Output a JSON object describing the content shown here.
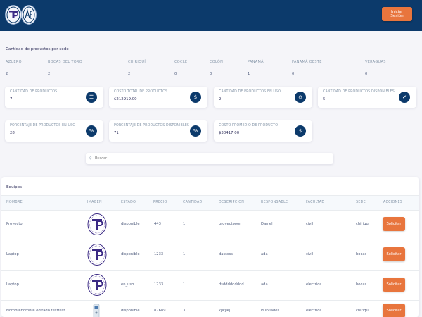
{
  "header": {
    "login_label": "Iniciar Sesión"
  },
  "sedes": {
    "title": "Cantidad de productos por sede",
    "columns": [
      "AZUERO",
      "BOCAS DEL TORO",
      "CHIRIQUÍ",
      "COCLÉ",
      "COLÓN",
      "PANAMÁ",
      "PANAMÁ OESTE",
      "VERAGUAS"
    ],
    "values": [
      "2",
      "2",
      "2",
      "0",
      "0",
      "1",
      "0",
      "0"
    ]
  },
  "stats": [
    {
      "label": "CANTIDAD DE PRODUCTOS",
      "value": "7",
      "icon": "table-icon"
    },
    {
      "label": "COSTO TOTAL DE PRODUCTOS",
      "value": "$212919.00",
      "icon": "dollar-icon"
    },
    {
      "label": "CANTIDAD DE PRODUCTOS EN USO",
      "value": "2",
      "icon": "in-use-icon"
    },
    {
      "label": "CANTIDAD DE PRODUCTOS DISPONIBLES",
      "value": "5",
      "icon": "check-icon"
    },
    {
      "label": "PORCENTAJE DE PRODUCTOS EN USO",
      "value": "28",
      "icon": "percent-icon"
    },
    {
      "label": "PORCENTAJE DE PRODUCTOS DISPONIBLES",
      "value": "71",
      "icon": "percent-icon"
    },
    {
      "label": "COSTO PROMEDIO DE PRODUCTO",
      "value": "$30417.00",
      "icon": "dollar-icon"
    }
  ],
  "search": {
    "placeholder": "Buscar..."
  },
  "equipos": {
    "title": "Equipos",
    "headers": [
      "NOMBRE",
      "IMAGEN",
      "ESTADO",
      "PRECIO",
      "CANTIDAD",
      "DESCRIPCION",
      "RESPONSABLE",
      "FACULTAD",
      "SEDE",
      "ACCIONES"
    ],
    "rows": [
      {
        "nombre": "Proyector",
        "estado": "disponible",
        "precio": "443",
        "cantidad": "1",
        "descripcion": "proyectooor",
        "responsable": "Daniel",
        "facultad": "civil",
        "sede": "chiriqui",
        "accion": "Solicitar"
      },
      {
        "nombre": "Laptop",
        "estado": "disponible",
        "precio": "1233",
        "cantidad": "1",
        "descripcion": "dasssss",
        "responsable": "ada",
        "facultad": "civil",
        "sede": "bocas",
        "accion": "Solicitar"
      },
      {
        "nombre": "Laptop",
        "estado": "en_uso",
        "precio": "1233",
        "cantidad": "1",
        "descripcion": "dsddddddddd",
        "responsable": "ada",
        "facultad": "electrica",
        "sede": "bocas",
        "accion": "Solicitar"
      },
      {
        "nombre": "Nombrenombre editado testtest",
        "estado": "disponible",
        "precio": "87689",
        "cantidad": "3",
        "descripcion": "kjlkjlkj",
        "responsable": "Hurviades",
        "facultad": "electrica",
        "sede": "chiriqui",
        "accion": "Solicitar"
      }
    ]
  },
  "colors": {
    "brand": "#0c3a6b",
    "accent": "#e8753d"
  }
}
